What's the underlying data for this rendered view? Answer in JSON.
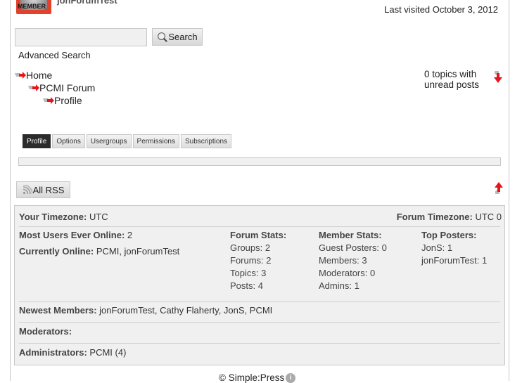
{
  "header": {
    "avatar_text": "MEMBER",
    "username": "jonForumTest",
    "last_visited": "Last visited October 3, 2012"
  },
  "search": {
    "value": "",
    "placeholder": "",
    "button_label": "Search",
    "advanced_link": "Advanced Search"
  },
  "breadcrumbs": [
    {
      "label": "Home"
    },
    {
      "label": "PCMI Forum"
    },
    {
      "label": "Profile"
    }
  ],
  "unread": {
    "line1": "0 topics with",
    "line2": "unread posts"
  },
  "tabs": [
    {
      "label": "Profile",
      "active": true
    },
    {
      "label": "Options",
      "active": false
    },
    {
      "label": "Usergroups",
      "active": false
    },
    {
      "label": "Permissions",
      "active": false
    },
    {
      "label": "Subscriptions",
      "active": false
    }
  ],
  "rss": {
    "label": "All RSS"
  },
  "stats": {
    "your_timezone_label": "Your Timezone:",
    "your_timezone_value": "UTC",
    "forum_timezone_label": "Forum Timezone:",
    "forum_timezone_value": "UTC 0",
    "most_online_label": "Most Users Ever Online:",
    "most_online_value": "2",
    "currently_online_label": "Currently Online:",
    "currently_online_value": "PCMI, jonForumTest",
    "forum_stats": {
      "title": "Forum Stats:",
      "items": [
        "Groups: 2",
        "Forums: 2",
        "Topics: 3",
        "Posts: 4"
      ]
    },
    "member_stats": {
      "title": "Member Stats:",
      "items": [
        "Guest Posters: 0",
        "Members: 3",
        "Moderators: 0",
        "Admins: 1"
      ]
    },
    "top_posters": {
      "title": "Top Posters:",
      "items": [
        "JonS: 1",
        "jonForumTest: 1"
      ]
    },
    "newest_members_label": "Newest Members:",
    "newest_members_value": "jonForumTest, Cathy Flaherty, JonS, PCMI",
    "moderators_label": "Moderators:",
    "moderators_value": "",
    "administrators_label": "Administrators:",
    "administrators_value": "PCMI (4)"
  },
  "footer": {
    "text": "© Simple:Press",
    "info_icon": "i"
  },
  "colors": {
    "accent_red": "#e8141b",
    "active_tab_bg": "#2b2b2b",
    "panel_bg": "#f0f0f0",
    "border": "#c8c8c8"
  }
}
